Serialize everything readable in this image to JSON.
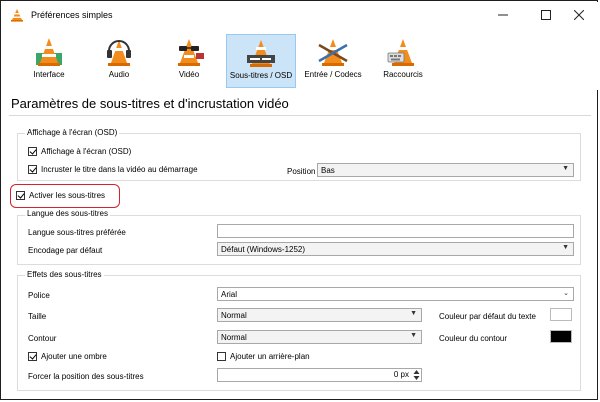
{
  "window": {
    "title": "Préférences simples"
  },
  "toolbar": {
    "items": [
      {
        "label": "Interface"
      },
      {
        "label": "Audio"
      },
      {
        "label": "Vidéo"
      },
      {
        "label": "Sous-titres / OSD"
      },
      {
        "label": "Entrée / Codecs"
      },
      {
        "label": "Raccourcis"
      }
    ]
  },
  "page": {
    "title": "Paramètres de sous-titres et d'incrustation vidéo"
  },
  "osd": {
    "group_title": "Affichage à l'écran (OSD)",
    "enable_osd_label": "Affichage à l'écran (OSD)",
    "enable_osd_checked": true,
    "show_title_label": "Incruster le titre dans la vidéo au démarrage",
    "show_title_checked": true,
    "position_label": "Position",
    "position_value": "Bas"
  },
  "subtitles": {
    "enable_label": "Activer les sous-titres",
    "enable_checked": true,
    "lang_group_title": "Langue des sous-titres",
    "preferred_lang_label": "Langue sous-titres préférée",
    "preferred_lang_value": "",
    "encoding_label": "Encodage par défaut",
    "encoding_value": "Défaut (Windows-1252)"
  },
  "effects": {
    "group_title": "Effets des sous-titres",
    "font_label": "Police",
    "font_value": "Arial",
    "size_label": "Taille",
    "size_value": "Normal",
    "text_color_label": "Couleur par défaut du texte",
    "text_color": "#ffffff",
    "outline_label": "Contour",
    "outline_value": "Normal",
    "outline_color_label": "Couleur du contour",
    "outline_color": "#000000",
    "shadow_label": "Ajouter une ombre",
    "shadow_checked": true,
    "background_label": "Ajouter un arrière-plan",
    "background_checked": false,
    "force_position_label": "Forcer la position des sous-titres",
    "force_position_value": "0 px"
  },
  "colors": {
    "highlight": "#d3232e",
    "active_tab": "#cce4f7",
    "cone_orange": "#f28c1c"
  }
}
